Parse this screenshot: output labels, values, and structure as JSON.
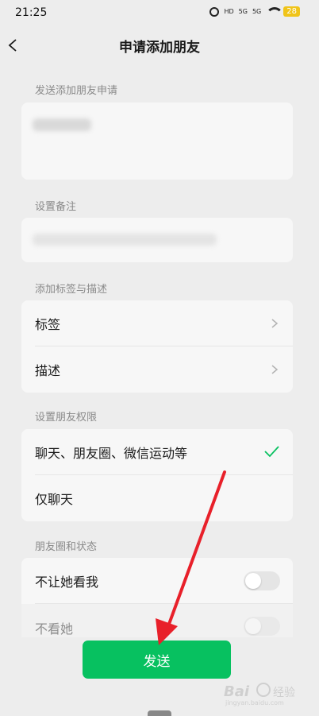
{
  "status_bar": {
    "time": "21:25",
    "hd": "HD",
    "signal1": "5G",
    "signal2": "5G",
    "battery": "28"
  },
  "header": {
    "title": "申请添加朋友"
  },
  "sections": {
    "request_label": "发送添加朋友申请",
    "remark_label": "设置备注",
    "tags_label": "添加标签与描述",
    "permission_label": "设置朋友权限",
    "moments_label": "朋友圈和状态"
  },
  "tags_rows": [
    {
      "label": "标签"
    },
    {
      "label": "描述"
    }
  ],
  "permission_rows": [
    {
      "label": "聊天、朋友圈、微信运动等",
      "selected": true
    },
    {
      "label": "仅聊天",
      "selected": false
    }
  ],
  "moments_rows": [
    {
      "label": "不让她看我",
      "enabled": false
    },
    {
      "label": "不看她",
      "enabled": false
    }
  ],
  "send_button": {
    "label": "发送"
  },
  "colors": {
    "accent_green": "#07c160",
    "annotation_red": "#e8202a"
  }
}
